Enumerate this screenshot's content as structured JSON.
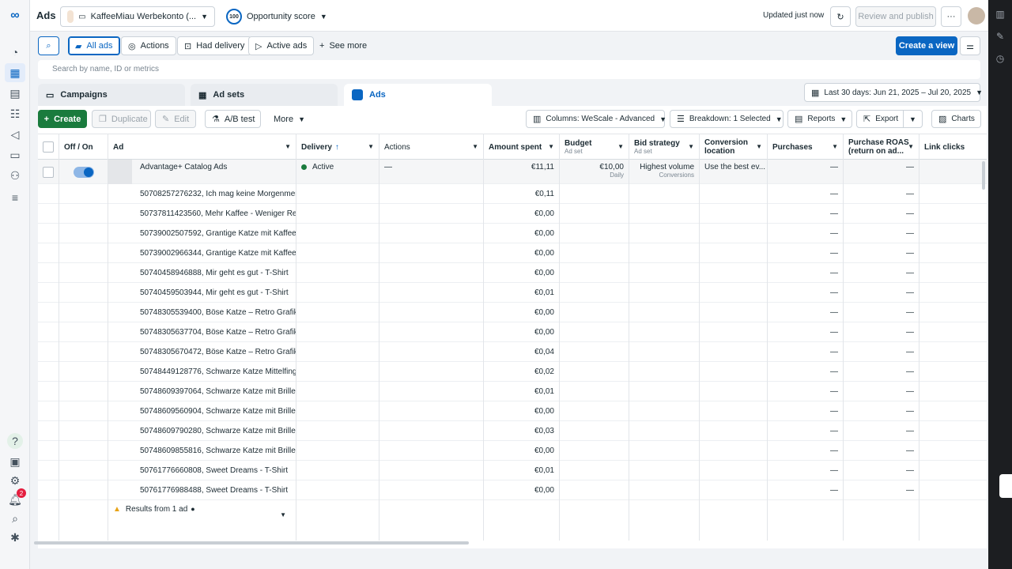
{
  "app": {
    "title": "Ads",
    "logo": "meta-logo-icon"
  },
  "topbar": {
    "account": "KaffeeMiau Werbekonto (...",
    "opportunity_score": "100",
    "opportunity_label": "Opportunity score",
    "updated": "Updated just now",
    "review_label": "Review and publish",
    "more_label": "···"
  },
  "filterbar": {
    "all_ads": "All ads",
    "actions": "Actions",
    "had_delivery": "Had delivery",
    "active_ads": "Active ads",
    "see_more": "See more",
    "create_view": "Create a view"
  },
  "search": {
    "placeholder": "Search by name, ID or metrics"
  },
  "tabs": {
    "campaigns": "Campaigns",
    "adsets": "Ad sets",
    "ads": "Ads"
  },
  "date_range": "Last 30 days: Jun 21, 2025 – Jul 20, 2025",
  "toolbar": {
    "create": "Create",
    "duplicate": "Duplicate",
    "edit": "Edit",
    "ab_test": "A/B test",
    "more": "More",
    "columns": "Columns: WeScale - Advanced",
    "breakdown": "Breakdown: 1 Selected",
    "reports": "Reports",
    "export": "Export",
    "charts": "Charts"
  },
  "columns": {
    "offon": "Off / On",
    "ad": "Ad",
    "delivery": "Delivery",
    "actions": "Actions",
    "amount_spent": "Amount spent",
    "budget": "Budget",
    "budget_sub": "Ad set",
    "bid_strategy": "Bid strategy",
    "bid_sub": "Ad set",
    "conversion_location_1": "Conversion",
    "conversion_location_2": "location",
    "purchases": "Purchases",
    "roas_1": "Purchase ROAS",
    "roas_2": "(return on ad...",
    "link_clicks": "Link clicks"
  },
  "parent_row": {
    "name": "Advantage+ Catalog Ads",
    "delivery": "Active",
    "actions": "—",
    "amount_spent": "€11,11",
    "budget": "€10,00",
    "budget_sub": "Daily",
    "bid_strategy": "Highest volume",
    "bid_sub": "Conversions",
    "conversion_location": "Use the best ev...",
    "purchases": "—",
    "roas": "—"
  },
  "rows": [
    {
      "name": "50708257276232, Ich mag keine Morgenmen...",
      "spent": "€0,11",
      "purchases": "—",
      "roas": "—"
    },
    {
      "name": "50737811423560, Mehr Kaffee - Weniger Re...",
      "spent": "€0,00",
      "purchases": "—",
      "roas": "—"
    },
    {
      "name": "50739002507592, Grantige Katze mit Kaffee ...",
      "spent": "€0,00",
      "purchases": "—",
      "roas": "—"
    },
    {
      "name": "50739002966344, Grantige Katze mit Kaffee ...",
      "spent": "€0,00",
      "purchases": "—",
      "roas": "—"
    },
    {
      "name": "50740458946888, Mir geht es gut - T-Shirt",
      "spent": "€0,00",
      "purchases": "—",
      "roas": "—"
    },
    {
      "name": "50740459503944, Mir geht es gut - T-Shirt",
      "spent": "€0,01",
      "purchases": "—",
      "roas": "—"
    },
    {
      "name": "50748305539400, Böse Katze – Retro Grafik ...",
      "spent": "€0,00",
      "purchases": "—",
      "roas": "—"
    },
    {
      "name": "50748305637704, Böse Katze – Retro Grafik ...",
      "spent": "€0,00",
      "purchases": "—",
      "roas": "—"
    },
    {
      "name": "50748305670472, Böse Katze – Retro Grafik ...",
      "spent": "€0,04",
      "purchases": "—",
      "roas": "—"
    },
    {
      "name": "50748449128776, Schwarze Katze Mittelfing...",
      "spent": "€0,02",
      "purchases": "—",
      "roas": "—"
    },
    {
      "name": "50748609397064, Schwarze Katze mit Brille ...",
      "spent": "€0,01",
      "purchases": "—",
      "roas": "—"
    },
    {
      "name": "50748609560904, Schwarze Katze mit Brille ...",
      "spent": "€0,00",
      "purchases": "—",
      "roas": "—"
    },
    {
      "name": "50748609790280, Schwarze Katze mit Brille ...",
      "spent": "€0,03",
      "purchases": "—",
      "roas": "—"
    },
    {
      "name": "50748609855816, Schwarze Katze mit Brille ...",
      "spent": "€0,00",
      "purchases": "—",
      "roas": "—"
    },
    {
      "name": "50761776660808, Sweet Dreams - T-Shirt",
      "spent": "€0,01",
      "purchases": "—",
      "roas": "—"
    },
    {
      "name": "50761776988488, Sweet Dreams - T-Shirt",
      "spent": "€0,00",
      "purchases": "—",
      "roas": "—"
    }
  ],
  "footer": {
    "results": "Results from 1 ad"
  },
  "notifications_count": "2",
  "colors": {
    "accent": "#0a66c2",
    "create": "#1a7b3d",
    "active": "#1a7b3d"
  }
}
